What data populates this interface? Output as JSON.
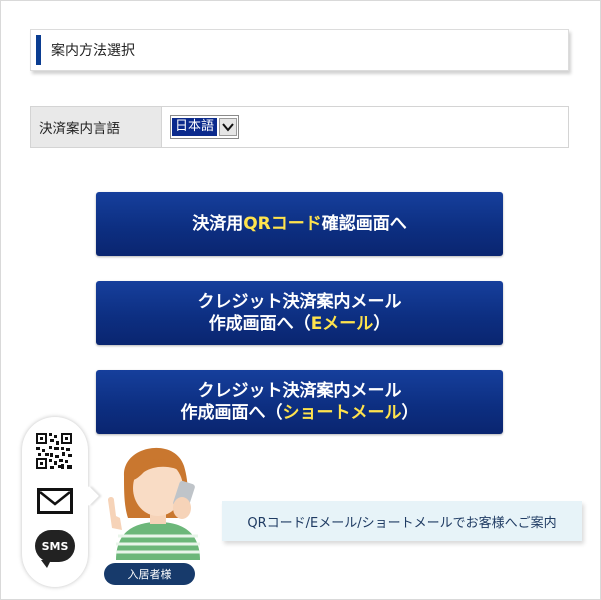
{
  "section": {
    "title": "案内方法選択"
  },
  "language": {
    "label": "決済案内言語",
    "selected": "日本語"
  },
  "buttons": [
    {
      "parts": [
        "決済用",
        "QRコード",
        "確認画面へ"
      ]
    },
    {
      "line1": "クレジット決済案内メール",
      "line2_pre": "作成画面へ（",
      "line2_hl": "Eメール",
      "line2_post": "）"
    },
    {
      "line1": "クレジット決済案内メール",
      "line2_pre": "作成画面へ（",
      "line2_hl": "ショートメール",
      "line2_post": "）"
    }
  ],
  "illustration": {
    "sms_label": "SMS",
    "role": "入居者様",
    "info": "QRコード/Eメール/ショートメールでお客様へご案内"
  },
  "colors": {
    "brand_navy": "#0b3d91",
    "button_highlight": "#ffe34d"
  }
}
